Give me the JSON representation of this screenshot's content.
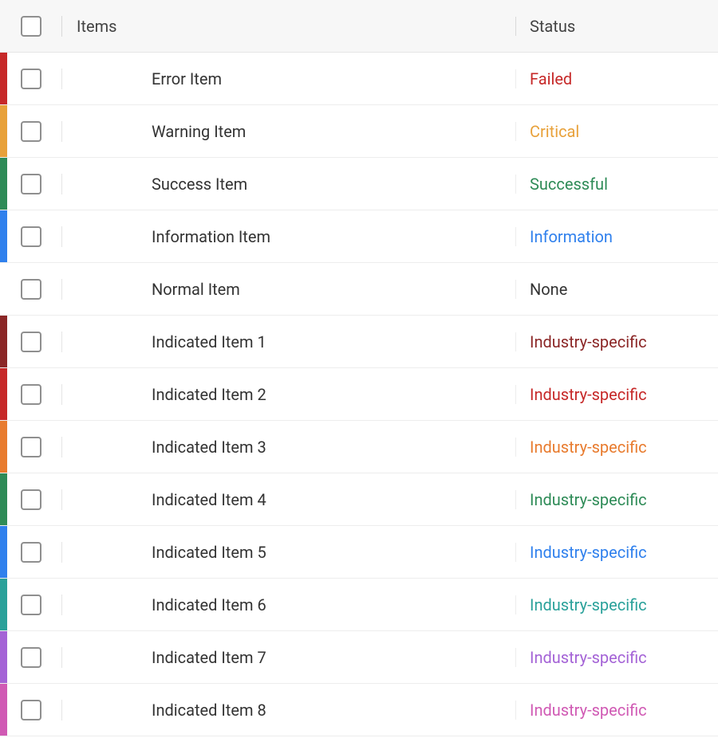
{
  "columns": {
    "items": "Items",
    "status": "Status"
  },
  "rows": [
    {
      "stripe": "#c62828",
      "item": "Error Item",
      "status": "Failed",
      "statusColor": "#c62828"
    },
    {
      "stripe": "#e8a13a",
      "item": "Warning Item",
      "status": "Critical",
      "statusColor": "#e8a13a"
    },
    {
      "stripe": "#2e8b57",
      "item": "Success Item",
      "status": "Successful",
      "statusColor": "#2e8b57"
    },
    {
      "stripe": "#2f80ed",
      "item": "Information Item",
      "status": "Information",
      "statusColor": "#2f80ed"
    },
    {
      "stripe": "",
      "item": "Normal Item",
      "status": "None",
      "statusColor": "#333333"
    },
    {
      "stripe": "#8b2626",
      "item": "Indicated Item 1",
      "status": "Industry-specific",
      "statusColor": "#8b2626"
    },
    {
      "stripe": "#c62828",
      "item": "Indicated Item 2",
      "status": "Industry-specific",
      "statusColor": "#c62828"
    },
    {
      "stripe": "#e87b2e",
      "item": "Indicated Item 3",
      "status": "Industry-specific",
      "statusColor": "#e87b2e"
    },
    {
      "stripe": "#2e8b57",
      "item": "Indicated Item 4",
      "status": "Industry-specific",
      "statusColor": "#2e8b57"
    },
    {
      "stripe": "#2f80ed",
      "item": "Indicated Item 5",
      "status": "Industry-specific",
      "statusColor": "#2f80ed"
    },
    {
      "stripe": "#2aa19a",
      "item": "Indicated Item 6",
      "status": "Industry-specific",
      "statusColor": "#2aa19a"
    },
    {
      "stripe": "#a463d6",
      "item": "Indicated Item 7",
      "status": "Industry-specific",
      "statusColor": "#a463d6"
    },
    {
      "stripe": "#d05ab4",
      "item": "Indicated Item 8",
      "status": "Industry-specific",
      "statusColor": "#d05ab4"
    }
  ]
}
